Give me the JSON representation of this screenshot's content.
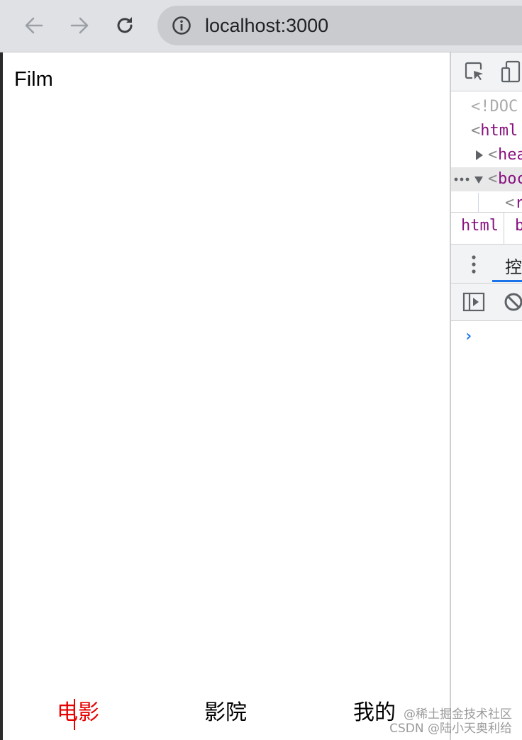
{
  "browser": {
    "url": "localhost:3000",
    "icons": [
      "back-arrow-icon",
      "forward-arrow-icon",
      "reload-icon",
      "info-icon"
    ]
  },
  "page": {
    "title": "Film",
    "tabbar": {
      "tabs": [
        {
          "label": "电影",
          "active": true
        },
        {
          "label": "影院",
          "active": false
        },
        {
          "label": "我的",
          "active": false
        }
      ],
      "active_color": "#e60000"
    }
  },
  "devtools": {
    "elements": {
      "lines": [
        {
          "text": "<!DOC"
        },
        {
          "open": "<",
          "tag": "html"
        },
        {
          "open": "<",
          "tag": "hea"
        },
        {
          "open": "<",
          "tag": "boc"
        },
        {
          "open": "<",
          "tag": "r"
        }
      ]
    },
    "breadcrumbs": [
      "html",
      "b"
    ],
    "drawer_tab": "控",
    "console_prompt": "›"
  },
  "watermark": {
    "line1": "@稀土掘金技术社区",
    "line2": "CSDN @陆小天奥利给"
  }
}
